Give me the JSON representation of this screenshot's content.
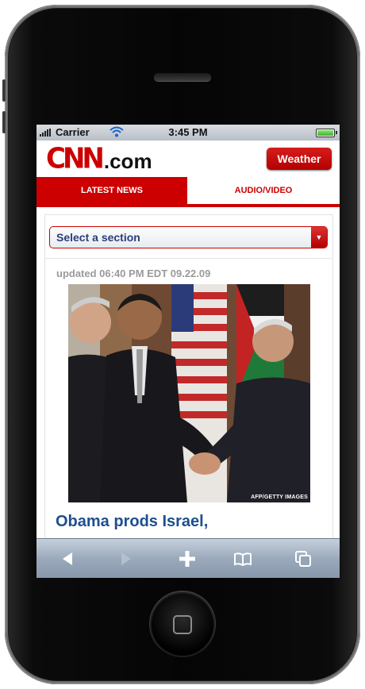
{
  "status_bar": {
    "carrier": "Carrier",
    "time": "3:45 PM"
  },
  "header": {
    "logo_mark": "CNN",
    "logo_suffix": ".com",
    "weather_button": "Weather"
  },
  "tabs": [
    {
      "label": "LATEST NEWS",
      "active": true
    },
    {
      "label": "AUDIO/VIDEO",
      "active": false
    }
  ],
  "section_select": {
    "selected": "Select a section"
  },
  "story": {
    "updated": "updated 06:40 PM EDT 09.22.09",
    "photo_credit": "AFP/GETTY IMAGES",
    "headline": "Obama prods Israel,"
  },
  "toolbar": {
    "buttons": [
      "back-icon",
      "forward-icon",
      "add-bookmark-icon",
      "bookmarks-icon",
      "pages-icon"
    ]
  },
  "colors": {
    "brand_red": "#cc0000",
    "headline_blue": "#1d4f8e",
    "select_text": "#2a3d7a"
  }
}
